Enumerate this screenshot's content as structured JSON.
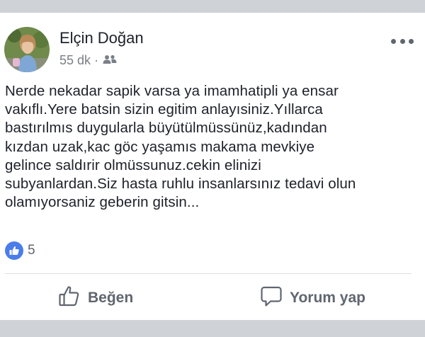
{
  "post": {
    "author": "Elçin Doğan",
    "time": "55 dk",
    "separator": "·",
    "audience_icon": "friends-icon",
    "menu_icon": "more-icon",
    "text": "Nerde nekadar sapik varsa ya imamhatipli ya ensar\nvakıflı.Yere batsin sizin egitim anlayısiniz.Yıllarca\nbastırılmıs duygularla büyütülmüssünüz,kadından\nkızdan uzak,kac göc yaşamıs makama mevkiye\ngelince saldırir olmüssunuz.cekin elinizi\nsubyanlardan.Siz hasta ruhlu insanlarsınız tedavi olun\nolamıyorsaniz geberin gitsin..."
  },
  "reactions": {
    "icon": "like-reaction-icon",
    "count": "5"
  },
  "actions": {
    "like_label": "Beğen",
    "comment_label": "Yorum yap"
  },
  "colors": {
    "accent": "#4a7dea",
    "text": "#1d2129",
    "secondary": "#60666f",
    "band": "#cfd2d7"
  }
}
